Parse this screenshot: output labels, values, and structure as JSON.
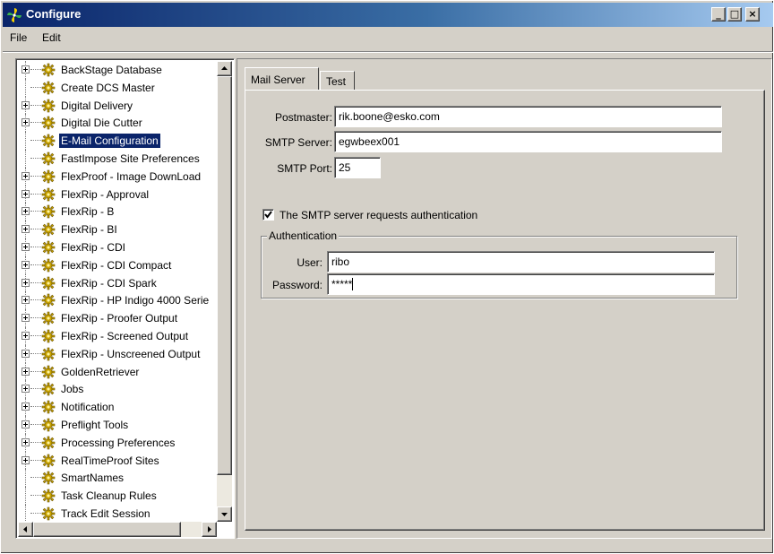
{
  "window": {
    "title": "Configure",
    "controls": {
      "minimize": "_",
      "maximize": "□",
      "close": "×"
    }
  },
  "menu": [
    "File",
    "Edit"
  ],
  "tree": {
    "items": [
      {
        "label": "BackStage Database",
        "expandable": true
      },
      {
        "label": "Create DCS Master",
        "expandable": false
      },
      {
        "label": "Digital Delivery",
        "expandable": true
      },
      {
        "label": "Digital Die Cutter",
        "expandable": true
      },
      {
        "label": "E-Mail Configuration",
        "expandable": false,
        "selected": true
      },
      {
        "label": "FastImpose Site Preferences",
        "expandable": false
      },
      {
        "label": "FlexProof - Image DownLoad",
        "expandable": true
      },
      {
        "label": "FlexRip - Approval",
        "expandable": true
      },
      {
        "label": "FlexRip - B",
        "expandable": true
      },
      {
        "label": "FlexRip - BI",
        "expandable": true
      },
      {
        "label": "FlexRip - CDI",
        "expandable": true
      },
      {
        "label": "FlexRip - CDI Compact",
        "expandable": true
      },
      {
        "label": "FlexRip - CDI Spark",
        "expandable": true
      },
      {
        "label": "FlexRip - HP Indigo 4000 Serie",
        "expandable": true
      },
      {
        "label": "FlexRip - Proofer Output",
        "expandable": true
      },
      {
        "label": "FlexRip - Screened Output",
        "expandable": true
      },
      {
        "label": "FlexRip - Unscreened Output",
        "expandable": true
      },
      {
        "label": "GoldenRetriever",
        "expandable": true
      },
      {
        "label": "Jobs",
        "expandable": true
      },
      {
        "label": "Notification",
        "expandable": true
      },
      {
        "label": "Preflight Tools",
        "expandable": true
      },
      {
        "label": "Processing Preferences",
        "expandable": true
      },
      {
        "label": "RealTimeProof Sites",
        "expandable": true
      },
      {
        "label": "SmartNames",
        "expandable": false
      },
      {
        "label": "Task Cleanup Rules",
        "expandable": false
      },
      {
        "label": "Track Edit Session",
        "expandable": false
      }
    ]
  },
  "tabs": [
    {
      "label": "Mail Server",
      "active": true
    },
    {
      "label": "Test",
      "active": false
    }
  ],
  "mail_server": {
    "postmaster_label": "Postmaster:",
    "postmaster_value": "rik.boone@esko.com",
    "smtp_server_label": "SMTP Server:",
    "smtp_server_value": "egwbeex001",
    "smtp_port_label": "SMTP Port:",
    "smtp_port_value": "25",
    "auth_checkbox_label": "The SMTP server requests authentication",
    "auth_checked": true,
    "auth_group_label": "Authentication",
    "user_label": "User:",
    "user_value": "ribo",
    "password_label": "Password:",
    "password_value": "*****"
  },
  "icons": {
    "app": "pinwheel-icon",
    "tree_node": "gear-icon",
    "expand": "plus-box-icon"
  }
}
